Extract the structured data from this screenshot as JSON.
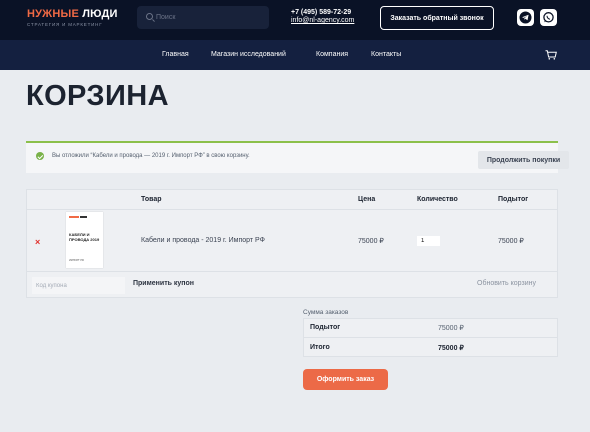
{
  "header": {
    "logo": {
      "part1": "НУЖНЫЕ",
      "part2": "ЛЮДИ",
      "tagline": "СТРАТЕГИЯ И МАРКЕТИНГ"
    },
    "search": {
      "placeholder": "Поиск"
    },
    "phone": "+7 (495) 589-72-29",
    "email": "info@nl-agency.com",
    "callback_label": "Заказать обратный звонок",
    "messengers": [
      {
        "icon": "telegram-icon"
      },
      {
        "icon": "whatsapp-icon"
      }
    ]
  },
  "nav": {
    "items": [
      {
        "label": "Главная"
      },
      {
        "label": "Магазин исследований"
      },
      {
        "label": "Компания"
      },
      {
        "label": "Контакты"
      }
    ],
    "cart_icon": "cart-icon"
  },
  "page": {
    "title": "КОРЗИНА"
  },
  "notice": {
    "text": "Вы отложили “Кабели и провода — 2019 г. Импорт РФ” в свою корзину.",
    "continue_label": "Продолжить покупки",
    "color": "#8cc04b"
  },
  "cart": {
    "columns": [
      "Товар",
      "Цена",
      "Количество",
      "Подытог"
    ],
    "items": [
      {
        "thumb_title": "КАБЕЛИ И ПРОВОДА 2019",
        "thumb_foot": "ИМПОРТ РФ",
        "name": "Кабели и провода - 2019 г. Импорт РФ",
        "price": "75000 ₽",
        "quantity": "1",
        "subtotal": "75000 ₽"
      }
    ],
    "remove_symbol": "×",
    "coupon_placeholder": "Код купона",
    "apply_coupon_label": "Применить купон",
    "update_cart_label": "Обновить корзину"
  },
  "totals": {
    "label": "Сумма заказов",
    "rows": [
      {
        "label": "Подытог",
        "value": "75000 ₽"
      },
      {
        "label": "Итого",
        "value": "75000 ₽"
      }
    ],
    "checkout_label": "Оформить заказ",
    "accent": "#ec6a47"
  }
}
